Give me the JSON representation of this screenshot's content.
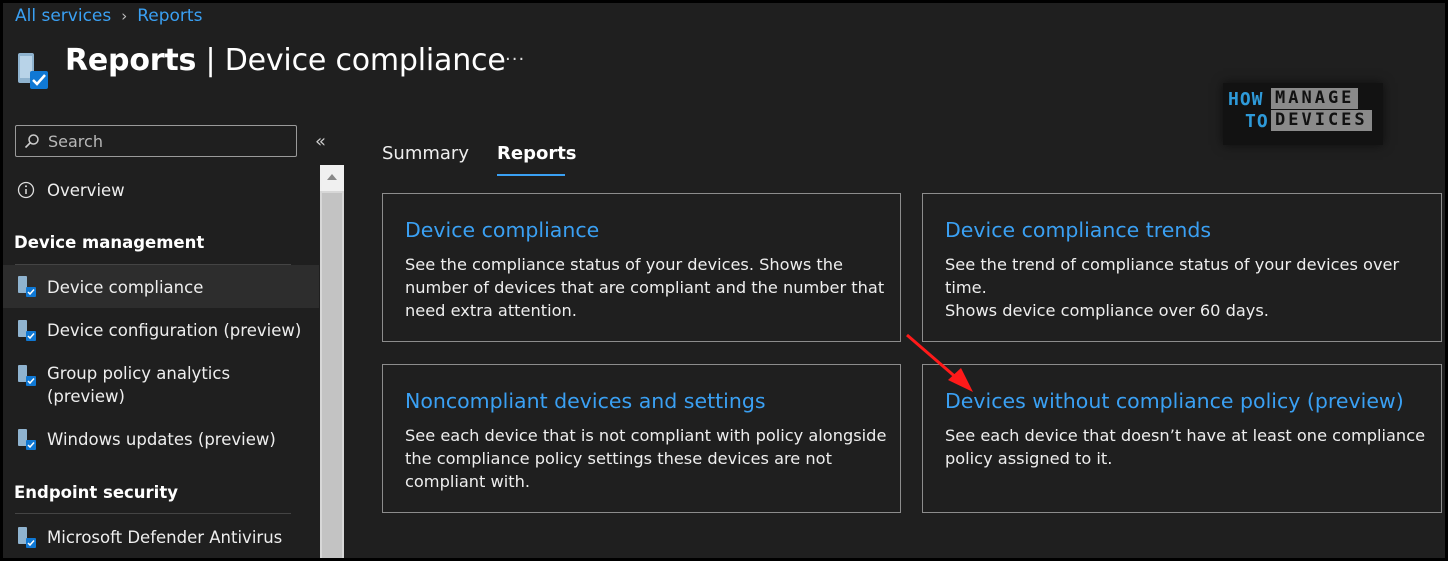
{
  "breadcrumb": {
    "items": [
      "All services",
      "Reports"
    ]
  },
  "header": {
    "title_bold": "Reports",
    "title_sep": " | ",
    "title_rest": "Device compliance",
    "more": "···"
  },
  "logo": {
    "line1a": "HOW",
    "line1b": "MANAGE",
    "line2a": "TO",
    "line2b": "DEVICES"
  },
  "search": {
    "placeholder": "Search",
    "value": ""
  },
  "collapse": "«",
  "sidebar": {
    "overview": "Overview",
    "section1": "Device management",
    "items": [
      "Device compliance",
      "Device configuration (preview)",
      "Group policy analytics",
      "(preview)",
      "Windows updates (preview)"
    ],
    "section2": "Endpoint security",
    "items2": [
      "Microsoft Defender Antivirus"
    ]
  },
  "tabs": [
    "Summary",
    "Reports"
  ],
  "cards": [
    {
      "title": "Device compliance",
      "desc": [
        "See the compliance status of your devices. Shows the",
        "number of devices that are compliant and the number that",
        "need extra attention."
      ]
    },
    {
      "title": "Device compliance trends",
      "desc": [
        "See the trend of compliance status of your devices over time.",
        "Shows device compliance over 60 days."
      ]
    },
    {
      "title": "Noncompliant devices and settings",
      "desc": [
        "See each device that is not compliant with policy alongside",
        "the compliance policy settings these devices are not",
        "compliant with."
      ]
    },
    {
      "title": "Devices without compliance policy (preview)",
      "desc": [
        "See each device that doesn’t have at least one compliance",
        "policy assigned to it."
      ]
    }
  ],
  "colors": {
    "accent": "#3aa0f3",
    "background": "#1f1f1f",
    "arrow": "#ff1a1a"
  }
}
